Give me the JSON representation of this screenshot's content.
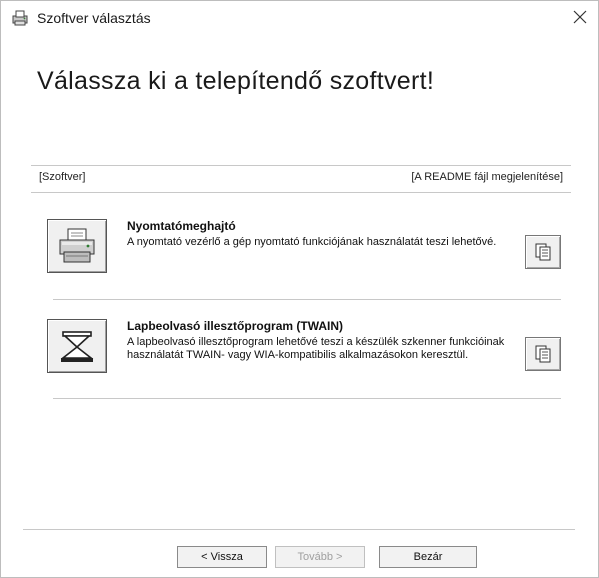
{
  "window": {
    "title": "Szoftver választás"
  },
  "heading": "Válassza ki a telepítendő szoftvert!",
  "section": {
    "left_label": "[Szoftver]",
    "right_label": "[A README fájl megjelenítése]"
  },
  "items": [
    {
      "title": "Nyomtatómeghajtó",
      "description": "A nyomtató vezérlő a gép nyomtató funkciójának használatát teszi lehetővé.",
      "icon": "printer-icon"
    },
    {
      "title": "Lapbeolvasó illesztőprogram (TWAIN)",
      "description": "A lapbeolvasó illesztőprogram lehetővé teszi a készülék szkenner funkcióinak használatát TWAIN- vagy WIA-kompatibilis alkalmazásokon keresztül.",
      "icon": "scanner-icon"
    }
  ],
  "buttons": {
    "back": "< Vissza",
    "next": "Tovább >",
    "close": "Bezár"
  }
}
